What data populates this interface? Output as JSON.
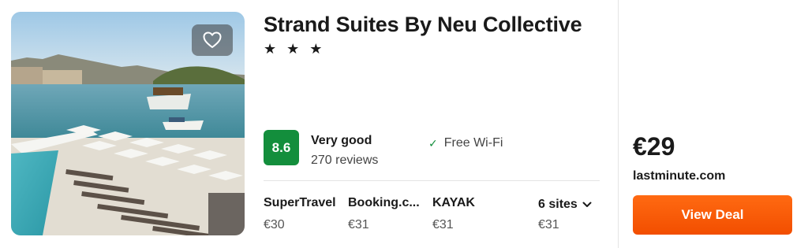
{
  "hotel": {
    "name": "Strand Suites By Neu Collective",
    "stars": "★ ★ ★",
    "rating_score": "8.6",
    "rating_label": "Very good",
    "review_count": "270 reviews",
    "amenity": "Free Wi-Fi",
    "icons": {
      "favorite": "heart-icon",
      "amenity": "checkmark-icon",
      "expand": "chevron-down-icon"
    }
  },
  "sites": [
    {
      "name": "SuperTravel",
      "price": "€30"
    },
    {
      "name": "Booking.c...",
      "price": "€31"
    },
    {
      "name": "KAYAK",
      "price": "€31"
    }
  ],
  "more_sites": {
    "label": "6 sites",
    "price": "€31"
  },
  "deal": {
    "price": "€29",
    "provider": "lastminute.com",
    "button_label": "View Deal"
  },
  "colors": {
    "rating_badge": "#138e3c",
    "deal_button": "#ff5a00"
  }
}
